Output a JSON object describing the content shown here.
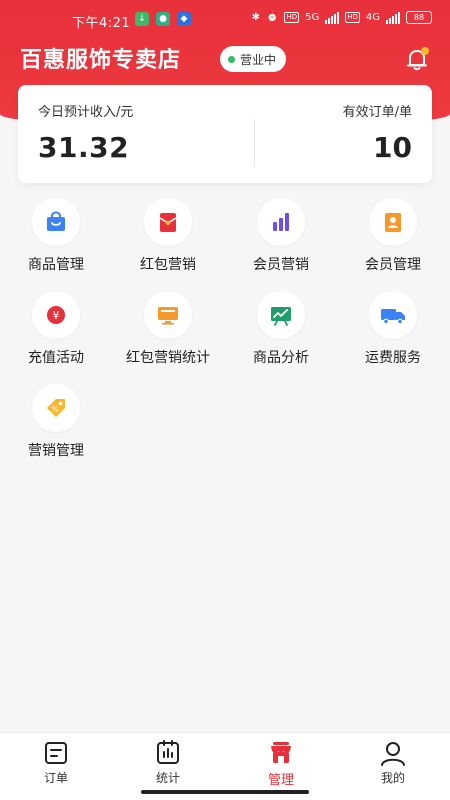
{
  "status_bar": {
    "time": "下午4:21",
    "network_5g": "5G",
    "network_4g": "4G",
    "hd": "HD",
    "battery": "88"
  },
  "header": {
    "store_name": "百惠服饰专卖店",
    "status_badge": "营业中"
  },
  "stats": {
    "income_label": "今日预计收入/元",
    "income_value": "31.32",
    "orders_label": "有效订单/单",
    "orders_value": "10"
  },
  "menu": [
    {
      "label": "商品管理",
      "icon": "shopping-bag-icon",
      "color": "#3b82f6"
    },
    {
      "label": "红包营销",
      "icon": "red-envelope-icon",
      "color": "#e8303a"
    },
    {
      "label": "会员营销",
      "icon": "bar-chart-icon",
      "color": "#6d4fe8"
    },
    {
      "label": "会员管理",
      "icon": "member-book-icon",
      "color": "#f59a2a"
    },
    {
      "label": "充值活动",
      "icon": "yuan-coin-icon",
      "color": "#e8303a"
    },
    {
      "label": "红包营销统计",
      "icon": "monitor-icon",
      "color": "#f59a2a"
    },
    {
      "label": "商品分析",
      "icon": "trend-board-icon",
      "color": "#1f9d6b"
    },
    {
      "label": "运费服务",
      "icon": "truck-icon",
      "color": "#3b82f6"
    },
    {
      "label": "营销管理",
      "icon": "tag-icon",
      "color": "#f5b82a"
    }
  ],
  "tabs": [
    {
      "label": "订单",
      "icon": "order-icon"
    },
    {
      "label": "统计",
      "icon": "stats-icon"
    },
    {
      "label": "管理",
      "icon": "manage-icon",
      "active": true
    },
    {
      "label": "我的",
      "icon": "profile-icon"
    }
  ],
  "colors": {
    "brand_red": "#e8303a",
    "open_dot": "#2dbd6b",
    "notification_dot": "#f5b82a"
  }
}
